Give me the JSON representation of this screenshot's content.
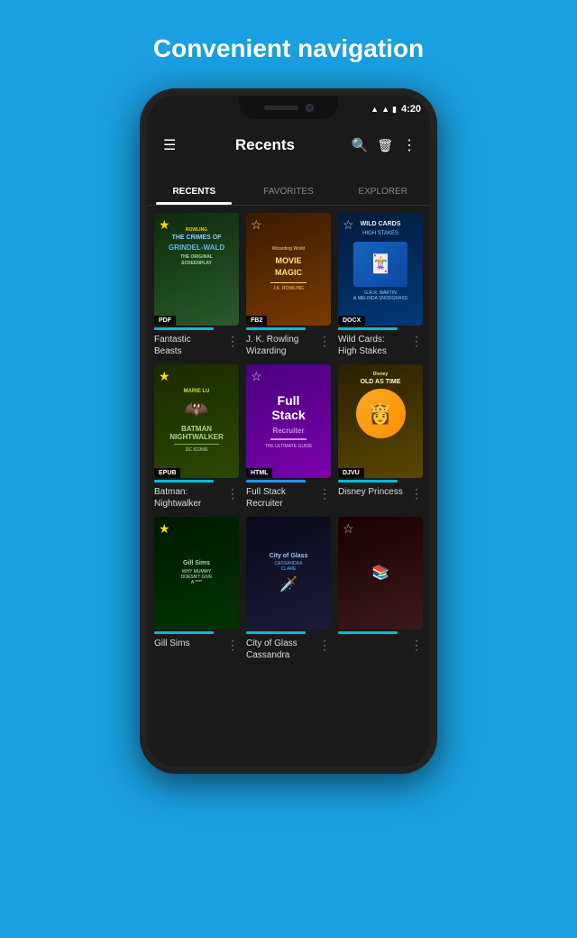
{
  "page": {
    "header": "Convenient navigation",
    "background_color": "#1a9fe0"
  },
  "status_bar": {
    "time": "4:20",
    "icons": [
      "wifi",
      "signal",
      "battery"
    ]
  },
  "app_bar": {
    "title": "Recents",
    "menu_icon": "☰",
    "search_icon": "🔍",
    "delete_icon": "🗑",
    "more_icon": "⋮"
  },
  "tabs": [
    {
      "label": "RECENTS",
      "active": true
    },
    {
      "label": "FAVORITES",
      "active": false
    },
    {
      "label": "EXPLORER",
      "active": false
    }
  ],
  "books": [
    {
      "title": "Fantastic\nBeasts",
      "format": "PDF",
      "star": true,
      "star_type": "filled",
      "accent": "teal",
      "cover_type": "fantastic"
    },
    {
      "title": "J. K. Rowling\nWizarding",
      "format": "FB2",
      "star": true,
      "star_type": "outline",
      "accent": "teal",
      "cover_type": "rowling"
    },
    {
      "title": "Wild Cards:\nHigh Stakes",
      "format": "DOCX",
      "star": true,
      "star_type": "outline",
      "accent": "teal",
      "cover_type": "wildcards"
    },
    {
      "title": "Batman:\nNightwalker",
      "format": "EPUB",
      "star": true,
      "star_type": "filled",
      "accent": "teal",
      "cover_type": "batman"
    },
    {
      "title": "Full Stack\nRecruiter",
      "format": "HTML",
      "star": true,
      "star_type": "outline",
      "accent": "blue",
      "cover_type": "fullstack"
    },
    {
      "title": "Disney Princess",
      "format": "DJVU",
      "star": false,
      "accent": "teal",
      "cover_type": "disney"
    },
    {
      "title": "Gill Sims",
      "format": "",
      "star": true,
      "star_type": "filled",
      "accent": "teal",
      "cover_type": "gill"
    },
    {
      "title": "City of Glass\nCassandra",
      "format": "",
      "star": false,
      "accent": "teal",
      "cover_type": "cassandra"
    },
    {
      "title": "",
      "format": "",
      "star": true,
      "star_type": "outline",
      "accent": "teal",
      "cover_type": "misc"
    }
  ],
  "book_more_label": "⋮"
}
